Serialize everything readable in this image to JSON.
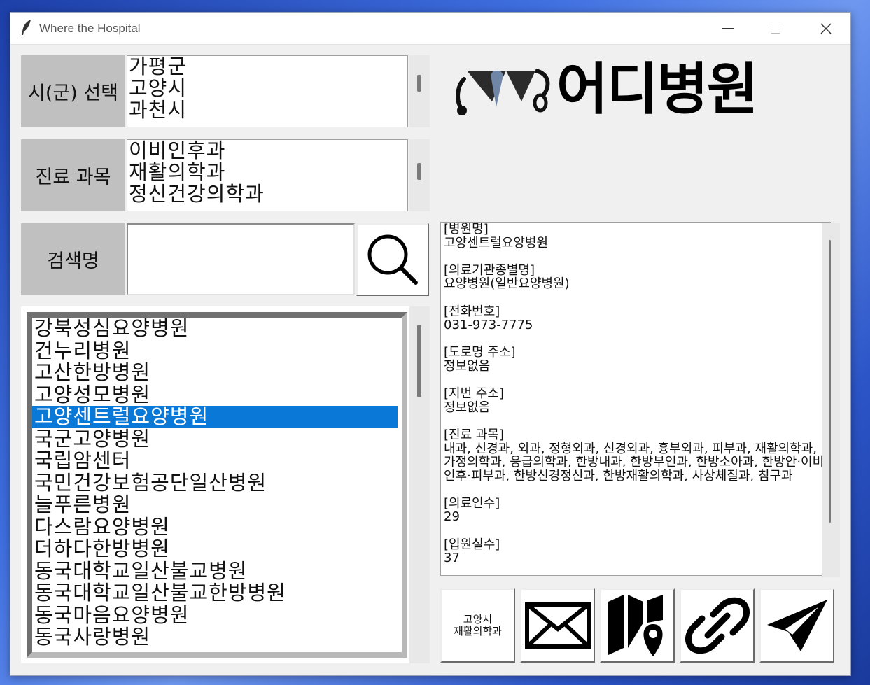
{
  "window": {
    "title": "Where the Hospital"
  },
  "brand": {
    "logo_text": "어디병원"
  },
  "city": {
    "label": "시(군) 선택",
    "options": [
      "가평군",
      "고양시",
      "과천시"
    ]
  },
  "department": {
    "label": "진료 과목",
    "options": [
      "이비인후과",
      "재활의학과",
      "정신건강의학과"
    ]
  },
  "search": {
    "label": "검색명",
    "value": ""
  },
  "hospitals": {
    "items": [
      "강북성심요양병원",
      "건누리병원",
      "고산한방병원",
      "고양성모병원",
      "고양센트럴요양병원",
      "국군고양병원",
      "국립암센터",
      "국민건강보험공단일산병원",
      "늘푸른병원",
      "다스람요양병원",
      "더하다한방병원",
      "동국대학교일산불교병원",
      "동국대학교일산불교한방병원",
      "동국마음요양병원",
      "동국사랑병원"
    ],
    "selected": "고양센트럴요양병원"
  },
  "details": {
    "text": "[병원명]\n고양센트럴요양병원\n\n[의료기관종별명]\n요양병원(일반요양병원)\n\n[전화번호]\n031-973-7775\n\n[도로명 주소]\n정보없음\n\n[지번 주소]\n정보없음\n\n[진료 과목]\n내과, 신경과, 외과, 정형외과, 신경외과, 흉부외과, 피부과, 재활의학과, 가정의학과, 응급의학과, 한방내과, 한방부인과, 한방소아과, 한방안·이비인후·피부과, 한방신경정신과, 한방재활의학과, 사상체질과, 침구과\n\n[의료인수]\n29\n\n[입원실수]\n37"
  },
  "actions": {
    "region_line1": "고양시",
    "region_line2": "재활의학과",
    "icons": [
      "envelope-icon",
      "map-pin-icon",
      "link-icon",
      "paper-plane-icon"
    ]
  },
  "colors": {
    "selection": "#0a78d7",
    "label_bg": "#c0c0c0",
    "window_bg": "#f0f0f0"
  }
}
